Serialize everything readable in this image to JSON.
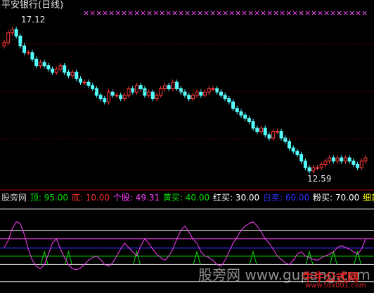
{
  "title": "平安银行(日线)",
  "price_labels": {
    "high": "17.12",
    "low": "12.59"
  },
  "indicator_labels": [
    {
      "text": "股旁网",
      "color": "#c8c8c8"
    },
    {
      "text": "顶: 95.00",
      "color": "#00e000"
    },
    {
      "text": "底: 10.00",
      "color": "#ff3030"
    },
    {
      "text": "个股: 49.31",
      "color": "#ff40ff"
    },
    {
      "text": "黄买: 40.00",
      "color": "#00e000"
    },
    {
      "text": "红买: 30.00",
      "color": "#ffffff"
    },
    {
      "text": "白卖: 60.00",
      "color": "#3030ff"
    },
    {
      "text": "粉买: 70.00",
      "color": "#ffffff"
    },
    {
      "text": "细黄",
      "color": "#ffff00"
    }
  ],
  "watermark": {
    "main": "股旁网 www.gupang.com",
    "brand": "牛牛公式网",
    "brand_url": "www.tdx001.com"
  },
  "colors": {
    "up": "#ff3b3b",
    "down": "#54ffff",
    "indicator": "#ff40ff",
    "signal": "#ffff80"
  },
  "chart_data": [
    {
      "type": "candlestick",
      "title": "平安银行(日线)",
      "annotations": [
        {
          "label": "17.12",
          "value": 17.12,
          "kind": "high"
        },
        {
          "label": "12.59",
          "value": 12.59,
          "kind": "low"
        }
      ],
      "close": [
        16.6,
        16.9,
        17.0,
        16.8,
        16.5,
        16.3,
        16.3,
        16.1,
        15.9,
        16.0,
        15.9,
        15.8,
        15.7,
        15.8,
        15.9,
        15.7,
        15.6,
        15.7,
        15.5,
        15.4,
        15.4,
        15.3,
        15.2,
        15.0,
        14.9,
        14.8,
        15.1,
        15.0,
        15.0,
        14.9,
        15.0,
        15.2,
        15.1,
        15.3,
        15.2,
        15.0,
        15.1,
        14.9,
        15.0,
        15.2,
        15.3,
        15.2,
        15.4,
        15.2,
        15.1,
        15.0,
        14.9,
        15.0,
        15.1,
        15.0,
        15.1,
        15.2,
        15.2,
        15.1,
        15.0,
        14.9,
        14.8,
        14.6,
        14.5,
        14.4,
        14.3,
        14.2,
        14.0,
        13.9,
        14.0,
        13.8,
        13.7,
        13.9,
        13.9,
        13.7,
        13.6,
        13.4,
        13.3,
        13.2,
        13.0,
        12.8,
        12.7,
        12.8,
        12.8,
        12.9,
        13.0,
        13.1,
        13.0,
        13.1,
        13.0,
        13.1,
        13.0,
        12.9,
        12.8,
        13.0,
        13.1
      ]
    },
    {
      "type": "line",
      "series": [
        {
          "values": [
            50,
            58,
            72,
            80,
            78,
            65,
            48,
            35,
            28,
            25,
            30,
            42,
            55,
            60,
            48,
            38,
            30,
            25,
            24,
            26,
            30,
            35,
            38,
            40,
            36,
            30,
            28,
            32,
            40,
            48,
            55,
            50,
            45,
            40,
            52,
            60,
            55,
            48,
            42,
            38,
            35,
            40,
            48,
            60,
            70,
            75,
            68,
            60,
            55,
            45,
            40,
            38,
            35,
            30,
            28,
            35,
            45,
            55,
            62,
            70,
            75,
            78,
            80,
            75,
            68,
            60,
            55,
            48,
            40,
            36,
            32,
            30,
            35,
            42,
            45,
            40,
            38,
            36,
            35,
            38,
            40,
            42,
            45,
            50,
            52,
            50,
            48,
            45,
            42,
            48,
            60
          ]
        },
        {
          "values": [
            null,
            null,
            null,
            null,
            null,
            null,
            null,
            null,
            null,
            null,
            null,
            null,
            null,
            null,
            null,
            null,
            null,
            null,
            null,
            null,
            null,
            null,
            null,
            null,
            null,
            null,
            null,
            null,
            null,
            null,
            null,
            null,
            null,
            null,
            null,
            null,
            null,
            null,
            null,
            null,
            null,
            null,
            null,
            null,
            null,
            null,
            null,
            null,
            null,
            null,
            null,
            null,
            null,
            null,
            null,
            null,
            null,
            null,
            null,
            null,
            null,
            null,
            null,
            null,
            null,
            null,
            null,
            null,
            null,
            null,
            null,
            null,
            null,
            null,
            null,
            null,
            null,
            null,
            null,
            null,
            null,
            null,
            null,
            null,
            null,
            null,
            null,
            null,
            null,
            null,
            null
          ]
        }
      ],
      "hlines": [
        95,
        10,
        49.31,
        40,
        30,
        60,
        70
      ]
    }
  ]
}
